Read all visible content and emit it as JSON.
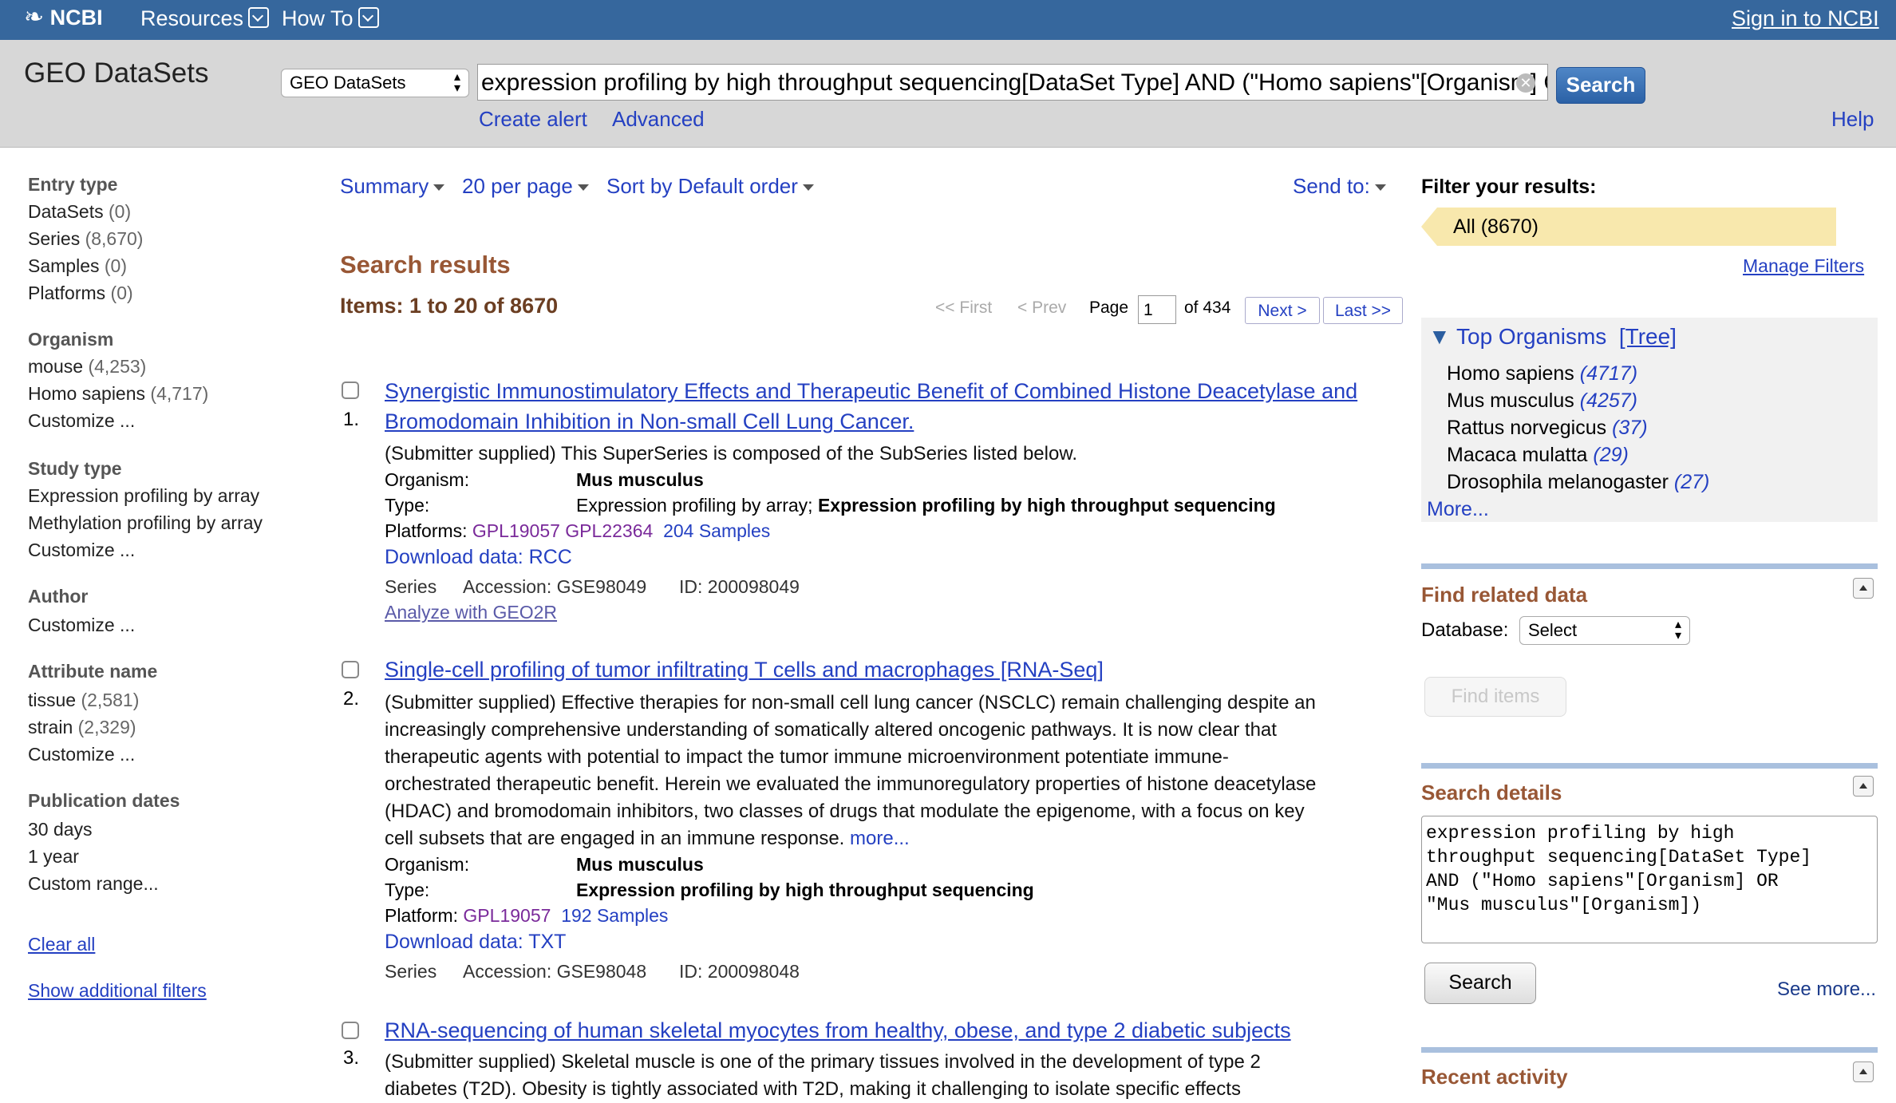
{
  "topbar": {
    "logo": "NCBI",
    "resources": "Resources",
    "howto": "How To",
    "signin": "Sign in to NCBI"
  },
  "searchbar": {
    "app_title": "GEO DataSets",
    "db_select": "GEO DataSets",
    "query": "expression profiling by high throughput sequencing[DataSet Type] AND (\"Homo sapiens\"[Organism] OR \"Mus musculus\"[Organism])",
    "search_button": "Search",
    "create_alert": "Create alert",
    "advanced": "Advanced",
    "help": "Help"
  },
  "sidebar": {
    "entry_type": {
      "heading": "Entry type",
      "items": [
        {
          "label": "DataSets",
          "count": "(0)"
        },
        {
          "label": "Series",
          "count": "(8,670)"
        },
        {
          "label": "Samples",
          "count": "(0)"
        },
        {
          "label": "Platforms",
          "count": "(0)"
        }
      ]
    },
    "organism": {
      "heading": "Organism",
      "items": [
        {
          "label": "mouse",
          "count": "(4,253)"
        },
        {
          "label": "Homo sapiens",
          "count": "(4,717)"
        }
      ],
      "customize": "Customize ..."
    },
    "study_type": {
      "heading": "Study type",
      "items": [
        "Expression profiling by array",
        "Methylation profiling by array"
      ],
      "customize": "Customize ..."
    },
    "author": {
      "heading": "Author",
      "customize": "Customize ..."
    },
    "attribute": {
      "heading": "Attribute name",
      "items": [
        {
          "label": "tissue",
          "count": "(2,581)"
        },
        {
          "label": "strain",
          "count": "(2,329)"
        }
      ],
      "customize": "Customize ..."
    },
    "pubdates": {
      "heading": "Publication dates",
      "items": [
        "30 days",
        "1 year",
        "Custom range..."
      ]
    },
    "clear_all": "Clear all",
    "show_additional": "Show additional filters"
  },
  "toolbar": {
    "summary": "Summary",
    "per_page": "20 per page",
    "sort": "Sort by Default order",
    "send_to": "Send to:"
  },
  "results": {
    "heading": "Search results",
    "items_range": "Items: 1 to 20 of 8670",
    "pager": {
      "first": "<< First",
      "prev": "< Prev",
      "page_label": "Page",
      "page_value": "1",
      "of": "of 434",
      "next": "Next >",
      "last": "Last >>"
    },
    "labels": {
      "organism": "Organism:",
      "type": "Type:",
      "platforms": "Platforms:",
      "platform": "Platform:",
      "series": "Series"
    },
    "list": [
      {
        "num": "1.",
        "title_l1": "Synergistic Immunostimulatory Effects and Therapeutic Benefit of Combined Histone Deacetylase and",
        "title_l2": "Bromodomain Inhibition in Non-small Cell Lung Cancer.",
        "summary": "(Submitter supplied) This SuperSeries is composed of the SubSeries listed below.",
        "organism": "Mus musculus",
        "type_plain": "Expression profiling by array; ",
        "type_bold": "Expression profiling by high throughput sequencing",
        "platform1": "GPL19057",
        "platform2": "GPL22364",
        "samples": "204 Samples",
        "download": "Download data: RCC",
        "accession": "Accession: GSE98049",
        "id": "ID: 200098049",
        "analyze": "Analyze with GEO2R"
      },
      {
        "num": "2.",
        "title_l1": "Single-cell profiling of tumor infiltrating T cells and macrophages [RNA-Seq]",
        "summary_lines": [
          "(Submitter supplied) Effective therapies for non-small cell lung cancer (NSCLC) remain challenging despite an",
          "increasingly comprehensive understanding of somatically altered oncogenic pathways. It is now clear that",
          "therapeutic agents with potential to impact the tumor immune microenvironment potentiate immune-",
          "orchestrated therapeutic benefit. Herein we evaluated the immunoregulatory properties of histone deacetylase",
          "(HDAC) and bromodomain inhibitors, two classes of drugs that modulate the epigenome, with a focus on key",
          "cell subsets that are engaged in an immune response. "
        ],
        "more": "more...",
        "organism": "Mus musculus",
        "type_bold": "Expression profiling by high throughput sequencing",
        "platform1": "GPL19057",
        "samples": "192 Samples",
        "download": "Download data: TXT",
        "accession": "Accession: GSE98048",
        "id": "ID: 200098048"
      },
      {
        "num": "3.",
        "title_l1": "RNA-sequencing of human skeletal myocytes from healthy, obese, and type 2 diabetic subjects",
        "summary_lines": [
          "(Submitter supplied) Skeletal muscle is one of the primary tissues involved in the development of type 2",
          "diabetes (T2D). Obesity is tightly associated with T2D, making it challenging to isolate specific effects"
        ]
      }
    ]
  },
  "right": {
    "filter_heading": "Filter your results:",
    "all_filter": "All (8670)",
    "manage_filters": "Manage Filters",
    "top_organisms": "Top Organisms",
    "tree": "[Tree]",
    "organisms": [
      {
        "name": "Homo sapiens",
        "count": "(4717)"
      },
      {
        "name": "Mus musculus",
        "count": "(4257)"
      },
      {
        "name": "Rattus norvegicus",
        "count": "(37)"
      },
      {
        "name": "Macaca mulatta",
        "count": "(29)"
      },
      {
        "name": "Drosophila melanogaster",
        "count": "(27)"
      }
    ],
    "more": "More...",
    "find_related": "Find related data",
    "database_label": "Database:",
    "database_select": "Select",
    "find_items": "Find items",
    "search_details": "Search details",
    "details_text": "expression profiling by high\nthroughput sequencing[DataSet Type]\nAND (\"Homo sapiens\"[Organism] OR\n\"Mus musculus\"[Organism])",
    "search_button": "Search",
    "see_more": "See more...",
    "recent_activity": "Recent activity"
  }
}
